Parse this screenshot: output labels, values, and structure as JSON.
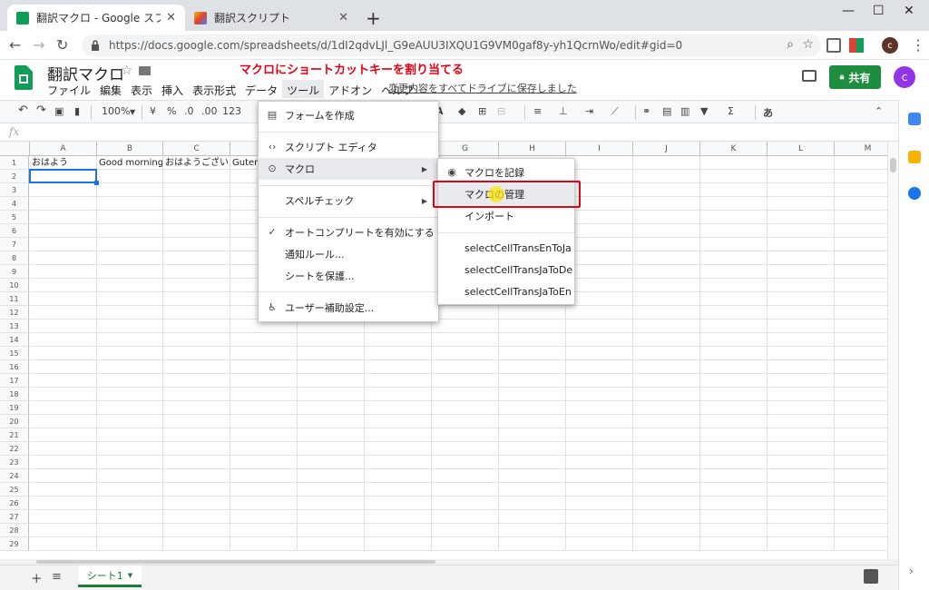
{
  "browser": {
    "tabs": [
      {
        "title": "翻訳マクロ - Google スプレッドシート",
        "active": true
      },
      {
        "title": "翻訳スクリプト",
        "active": false
      }
    ],
    "url": "https://docs.google.com/spreadsheets/d/1dI2qdvLJl_G9eAUU3IXQU1G9VM0gaf8y-yh1QcrnWo/edit#gid=0",
    "profile_initial": "c"
  },
  "app": {
    "doc_title": "翻訳マクロ",
    "annotation": "マクロにショートカットキーを割り当てる",
    "menus": [
      "ファイル",
      "編集",
      "表示",
      "挿入",
      "表示形式",
      "データ",
      "ツール",
      "アドオン",
      "ヘルプ"
    ],
    "open_menu": "ツール",
    "save_status": "変更内容をすべてドライブに保存しました",
    "share_label": "共有",
    "avatar_initial": "c"
  },
  "toolbar": {
    "zoom": "100%",
    "currency": "¥",
    "percent": "%",
    "decimal_less": ".0",
    "decimal_more": ".00",
    "number_format": "123",
    "input_method": "あ"
  },
  "formula_bar": {
    "fx": "fx"
  },
  "sheet": {
    "columns": [
      "A",
      "B",
      "C",
      "D",
      "E",
      "F",
      "G",
      "H",
      "I",
      "J",
      "K",
      "L",
      "M"
    ],
    "rows": [
      "1",
      "2",
      "3",
      "4",
      "5",
      "6",
      "7",
      "8",
      "9",
      "10",
      "11",
      "12",
      "13",
      "14",
      "15",
      "16",
      "17",
      "18",
      "19",
      "20",
      "21",
      "22",
      "23",
      "24",
      "25",
      "26",
      "27",
      "28",
      "29"
    ],
    "cells": {
      "A1": "おはよう",
      "B1": "Good morning",
      "C1": "おはようございます",
      "D1": "Guten"
    },
    "selected": "A2",
    "sheet_tab": "シート1"
  },
  "tools_menu": {
    "items": [
      {
        "label": "フォームを作成",
        "icon": "form-icon"
      },
      {
        "label": "スクリプト エディタ",
        "icon": "code-icon"
      },
      {
        "label": "マクロ",
        "icon": "macro-icon",
        "submenu": true
      },
      {
        "label": "スペルチェック",
        "submenu": true
      },
      {
        "label": "オートコンプリートを有効にする",
        "icon": "check-icon"
      },
      {
        "label": "通知ルール..."
      },
      {
        "label": "シートを保護..."
      },
      {
        "label": "ユーザー補助設定...",
        "icon": "accessibility-icon"
      }
    ]
  },
  "macro_menu": {
    "items": [
      {
        "label": "マクロを記録",
        "icon": "record-icon"
      },
      {
        "label": "マクロの管理"
      },
      {
        "label": "インポート"
      },
      {
        "label": "selectCellTransEnToJa"
      },
      {
        "label": "selectCellTransJaToDe"
      },
      {
        "label": "selectCellTransJaToEn"
      }
    ]
  },
  "colors": {
    "accent_green": "#0f9d58",
    "share_green": "#1e8e3e",
    "annotation_red": "#e60012",
    "selection_blue": "#1a73e8"
  }
}
